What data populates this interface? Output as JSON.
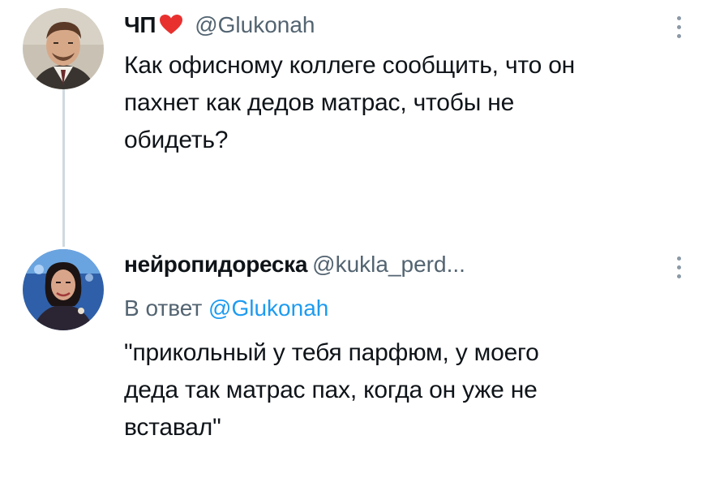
{
  "tweets": [
    {
      "display_name": "ЧП",
      "handle": "@Glukonah",
      "text_lines": [
        "Как офисному коллеге сообщить, что он",
        "пахнет как дедов матрас, чтобы не",
        "обидеть?"
      ]
    },
    {
      "display_name": "нейропидореска",
      "handle": "@kukla_perd...",
      "reply_prefix": "В ответ",
      "reply_mention": "@Glukonah",
      "text_lines": [
        "\"прикольный у тебя парфюм, у моего",
        "деда так матрас пах, когда он уже не",
        "вставал\""
      ]
    }
  ],
  "colors": {
    "text": "#0f1419",
    "secondary": "#536471",
    "mention": "#1d9bf0",
    "heart": "#f91880",
    "thread_line": "#cfd9de"
  }
}
